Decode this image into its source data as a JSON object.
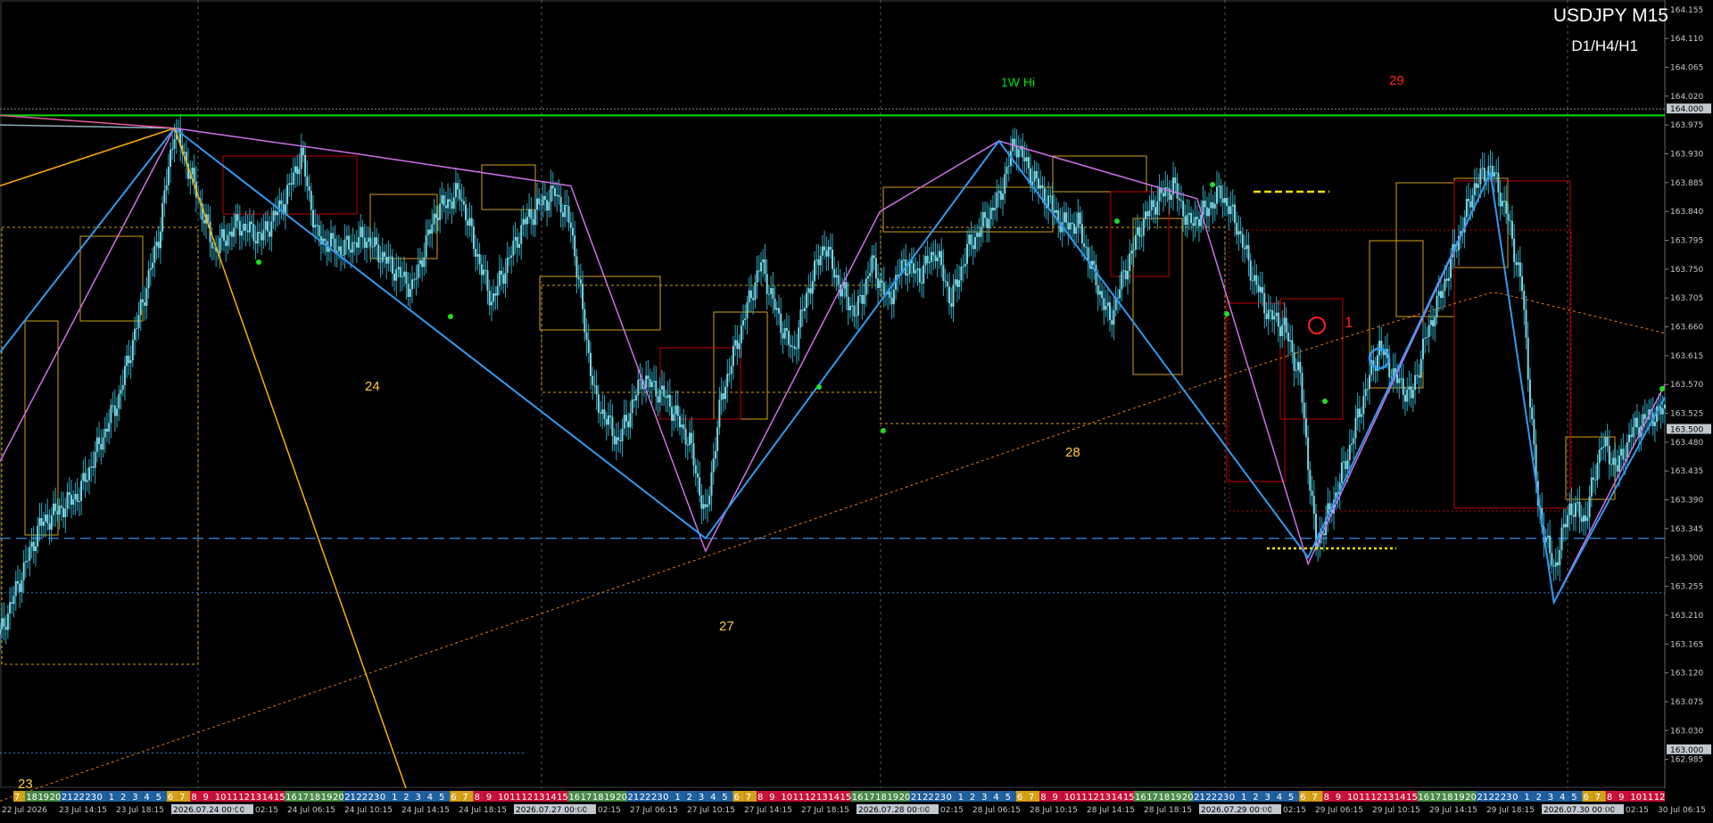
{
  "header": {
    "symbol_title": "USDJPY M15",
    "tf_label": "D1/H4/H1"
  },
  "colors": {
    "background": "#000000",
    "grid": "#5a5a5a",
    "candle_body": "#7ad7e6",
    "candle_wick": "#2fa8c0",
    "week_high_line": "#00e000",
    "zigzag_blue": "#2e9bf0",
    "zigzag_violet": "#d070e8",
    "fib_orange": "#ffb000",
    "box_gold": "#d4a017",
    "box_red": "#c00000",
    "dashed_blue": "#2e7fd0",
    "ma_orange": "#e07820",
    "ma_blue": "#3070c0",
    "dot_green": "#22dd22",
    "label_yellow": "#ffcc33",
    "label_red": "#ff2020",
    "price_tag_bg": "#c0c8d0"
  },
  "annotations": {
    "week_high": "1W Hi",
    "day_label_29": "29",
    "day_label_24": "24",
    "day_label_28": "28",
    "day_label_27": "27",
    "day_label_23": "23",
    "signal_label": "1"
  },
  "chart_data": {
    "type": "candlestick",
    "symbol": "USDJPY",
    "timeframe": "M15",
    "ylim": [
      162.94,
      164.17
    ],
    "price_axis_ticks": [
      "164.155",
      "164.110",
      "164.065",
      "164.020",
      "163.975",
      "163.930",
      "163.885",
      "163.840",
      "163.795",
      "163.750",
      "163.705",
      "163.660",
      "163.615",
      "163.570",
      "163.525",
      "163.480",
      "163.435",
      "163.390",
      "163.345",
      "163.300",
      "163.255",
      "163.210",
      "163.165",
      "163.120",
      "163.075",
      "163.030",
      "162.985"
    ],
    "price_tags": [
      {
        "label": "164.000",
        "price": 164.0
      },
      {
        "label": "163.500",
        "price": 163.5
      },
      {
        "label": "163.000",
        "price": 163.0
      }
    ],
    "time_labels": [
      "22 Jul 2026",
      "23 Jul 14:15",
      "23 Jul 18:15",
      "2026.07.24 00:00",
      "24 Jul 02:15",
      "24 Jul 06:15",
      "24 Jul 10:15",
      "24 Jul 14:15",
      "24 Jul 18:15",
      "2026.07.27 00:00",
      "27 Jul 02:15",
      "27 Jul 06:15",
      "27 Jul 10:15",
      "27 Jul 14:15",
      "27 Jul 18:15",
      "2026.07.28 00:00",
      "28 Jul 02:15",
      "28 Jul 06:15",
      "28 Jul 10:15",
      "28 Jul 14:15",
      "28 Jul 18:15",
      "2026.07.29 00:00",
      "29 Jul 02:15",
      "29 Jul 06:15",
      "29 Jul 10:15",
      "29 Jul 14:15",
      "29 Jul 18:15",
      "2026.07.30 00:00",
      "30 Jul 02:15",
      "30 Jul 06:15"
    ],
    "hour_strip": [
      "7",
      "18",
      "19",
      "20",
      "21",
      "22",
      "23",
      "0",
      "1",
      "2",
      "3",
      "4",
      "5",
      "6",
      "7",
      "8",
      "9",
      "10",
      "11",
      "12",
      "13",
      "14",
      "15",
      "16",
      "17",
      "18",
      "19",
      "20",
      "21",
      "22",
      "23",
      "0",
      "1",
      "2",
      "3",
      "4",
      "5",
      "6",
      "7",
      "8",
      "9",
      "10",
      "11",
      "12",
      "13",
      "14",
      "15",
      "16",
      "17",
      "18",
      "19",
      "20",
      "21",
      "22",
      "23",
      "0",
      "1",
      "2",
      "3",
      "4",
      "5",
      "6",
      "7",
      "8",
      "9",
      "10",
      "11",
      "12",
      "13",
      "14",
      "15",
      "16",
      "17",
      "18",
      "19",
      "20",
      "21",
      "22",
      "23",
      "0",
      "1",
      "2",
      "3",
      "4",
      "5",
      "6",
      "7",
      "8",
      "9",
      "10",
      "11",
      "12",
      "13",
      "14",
      "15",
      "16",
      "17",
      "18",
      "19",
      "20",
      "21",
      "22",
      "23",
      "0",
      "1",
      "2",
      "3",
      "4",
      "5",
      "6",
      "7",
      "8",
      "9",
      "10",
      "11",
      "12",
      "13",
      "14",
      "15",
      "16",
      "17",
      "18",
      "19",
      "20",
      "21",
      "22",
      "23",
      "0",
      "1",
      "2",
      "3",
      "4",
      "5",
      "6",
      "7",
      "8",
      "9",
      "10",
      "11",
      "12"
    ],
    "close_path": [
      [
        0,
        163.18
      ],
      [
        5,
        163.35
      ],
      [
        10,
        163.4
      ],
      [
        15,
        163.55
      ],
      [
        20,
        163.8
      ],
      [
        22,
        163.97
      ],
      [
        24,
        163.9
      ],
      [
        27,
        163.78
      ],
      [
        30,
        163.82
      ],
      [
        33,
        163.8
      ],
      [
        36,
        163.86
      ],
      [
        38,
        163.93
      ],
      [
        40,
        163.8
      ],
      [
        43,
        163.78
      ],
      [
        46,
        163.8
      ],
      [
        49,
        163.76
      ],
      [
        52,
        163.72
      ],
      [
        55,
        163.84
      ],
      [
        58,
        163.87
      ],
      [
        60,
        163.78
      ],
      [
        62,
        163.7
      ],
      [
        64,
        163.76
      ],
      [
        66,
        163.82
      ],
      [
        68,
        163.85
      ],
      [
        70,
        163.87
      ],
      [
        72,
        163.82
      ],
      [
        75,
        163.55
      ],
      [
        78,
        163.48
      ],
      [
        81,
        163.58
      ],
      [
        84,
        163.55
      ],
      [
        87,
        163.48
      ],
      [
        89,
        163.36
      ],
      [
        91,
        163.55
      ],
      [
        94,
        163.68
      ],
      [
        96,
        163.76
      ],
      [
        98,
        163.68
      ],
      [
        100,
        163.62
      ],
      [
        102,
        163.72
      ],
      [
        104,
        163.79
      ],
      [
        106,
        163.72
      ],
      [
        108,
        163.68
      ],
      [
        110,
        163.76
      ],
      [
        112,
        163.7
      ],
      [
        114,
        163.76
      ],
      [
        116,
        163.74
      ],
      [
        118,
        163.78
      ],
      [
        120,
        163.7
      ],
      [
        122,
        163.78
      ],
      [
        124,
        163.82
      ],
      [
        126,
        163.86
      ],
      [
        128,
        163.95
      ],
      [
        130,
        163.9
      ],
      [
        132,
        163.86
      ],
      [
        134,
        163.82
      ],
      [
        136,
        163.82
      ],
      [
        138,
        163.74
      ],
      [
        140,
        163.67
      ],
      [
        142,
        163.75
      ],
      [
        144,
        163.82
      ],
      [
        146,
        163.86
      ],
      [
        148,
        163.88
      ],
      [
        150,
        163.82
      ],
      [
        152,
        163.84
      ],
      [
        154,
        163.87
      ],
      [
        156,
        163.82
      ],
      [
        158,
        163.74
      ],
      [
        160,
        163.68
      ],
      [
        162,
        163.66
      ],
      [
        164,
        163.58
      ],
      [
        166,
        163.32
      ],
      [
        168,
        163.38
      ],
      [
        170,
        163.46
      ],
      [
        172,
        163.55
      ],
      [
        174,
        163.63
      ],
      [
        176,
        163.58
      ],
      [
        178,
        163.55
      ],
      [
        180,
        163.65
      ],
      [
        182,
        163.72
      ],
      [
        184,
        163.8
      ],
      [
        186,
        163.88
      ],
      [
        188,
        163.91
      ],
      [
        190,
        163.84
      ],
      [
        192,
        163.72
      ],
      [
        194,
        163.38
      ],
      [
        196,
        163.28
      ],
      [
        198,
        163.38
      ],
      [
        200,
        163.36
      ],
      [
        202,
        163.48
      ],
      [
        204,
        163.44
      ],
      [
        206,
        163.5
      ],
      [
        208,
        163.52
      ],
      [
        210,
        163.53
      ]
    ],
    "zigzag_points": [
      [
        0,
        163.45
      ],
      [
        22,
        163.97
      ],
      [
        45,
        163.93
      ],
      [
        72,
        163.88
      ],
      [
        89,
        163.31
      ],
      [
        111,
        163.84
      ],
      [
        126,
        163.95
      ],
      [
        151,
        163.86
      ],
      [
        165,
        163.29
      ],
      [
        188,
        163.9
      ],
      [
        196,
        163.23
      ],
      [
        210,
        163.57
      ]
    ],
    "levels": [
      {
        "name": "1W Hi",
        "price": 163.99
      },
      {
        "name": "dashed",
        "price": 163.33
      }
    ]
  }
}
